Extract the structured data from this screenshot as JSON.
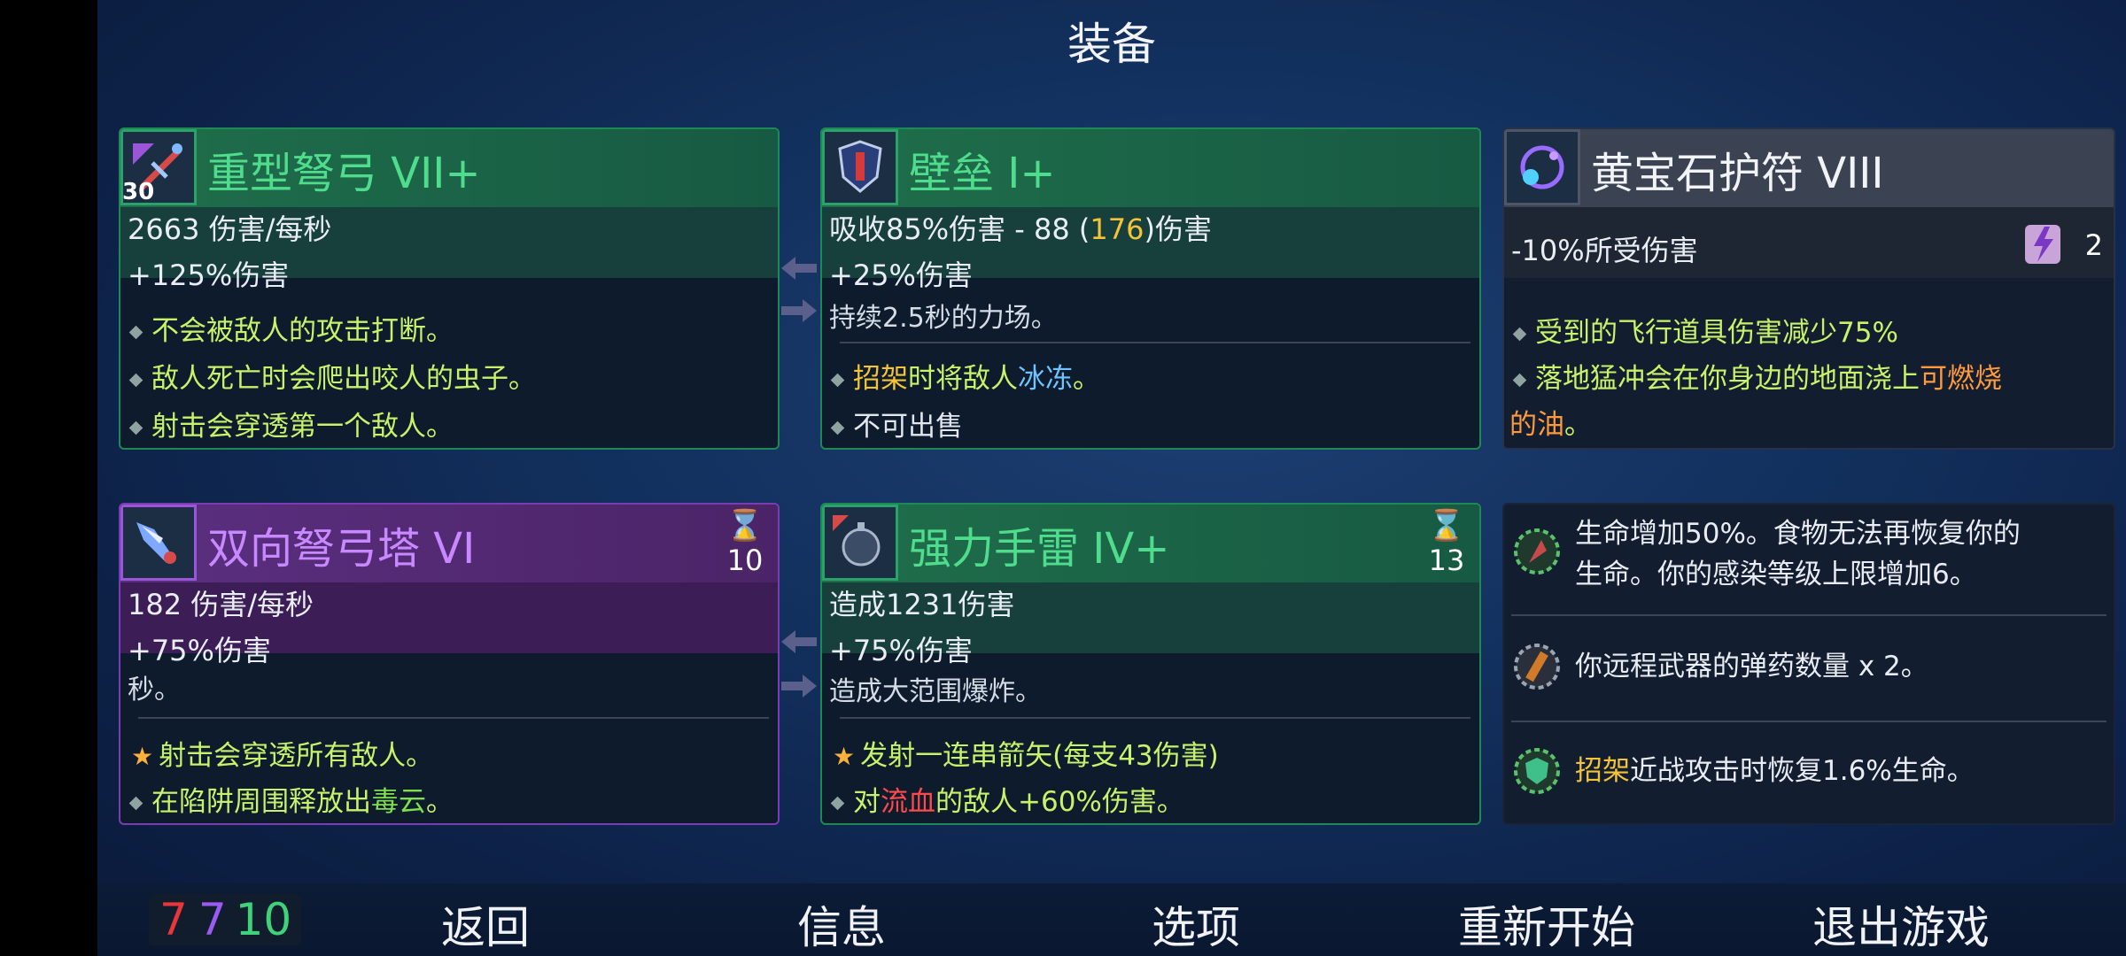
{
  "header": {
    "title": "装备"
  },
  "weapons": [
    {
      "level_badge": "30",
      "name": "重型弩弓 VII+",
      "dps": "2663 伤害/每秒",
      "bonus": "+125%伤害",
      "bullets": [
        "不会被敌人的攻击打断。",
        "敌人死亡时会爬出咬人的虫子。",
        "射击会穿透第一个敌人。"
      ]
    },
    {
      "name": "壁垒 I+",
      "stat_a": "吸收85%伤害 - 88 (",
      "stat_highlight": "176",
      "stat_b": ")伤害",
      "bonus": "+25%伤害",
      "desc": "持续2.5秒的力场。",
      "bullet1_a": "招架",
      "bullet1_b": "时将敌人",
      "bullet1_c": "冰冻",
      "bullet1_d": "。",
      "bullet2": "不可出售"
    },
    {
      "name": "黄宝石护符 VIII",
      "stat": "-10%所受伤害",
      "scroll_count": "2",
      "bullet1": "受到的飞行道具伤害减少75%",
      "bullet2_a": "落地猛冲会在你身边的地面浇上",
      "bullet2_b": "可燃烧",
      "bullet2_c": "的油",
      "bullet2_d": "。"
    },
    {
      "name": "双向弩弓塔 VI",
      "timer": "10",
      "dps": "182 伤害/每秒",
      "bonus": "+75%伤害",
      "desc": "秒。",
      "bullet1": "射击会穿透所有敌人。",
      "bullet2_a": "在陷阱周围释放出",
      "bullet2_b": "毒云",
      "bullet2_c": "。"
    },
    {
      "name": "强力手雷 IV+",
      "timer": "13",
      "dmg": "造成1231伤害",
      "bonus": "+75%伤害",
      "desc": "造成大范围爆炸。",
      "bullet1": "发射一连串箭矢(每支43伤害)",
      "bullet2_a": "对",
      "bullet2_b": "流血",
      "bullet2_c": "的敌人+60%伤害。"
    }
  ],
  "mutations": {
    "m1_line1": "生命增加50%。食物无法再恢复你的",
    "m1_line2": "生命。你的感染等级上限增加6。",
    "m2": "你远程武器的弹药数量 x 2。",
    "m3_a": "招架",
    "m3_b": "近战攻击时恢复1.6%生命。"
  },
  "stats": {
    "brutality": "7",
    "tactics": "7",
    "survival": "10",
    "colors": {
      "brutality": "#e8363a",
      "tactics": "#9a5cf0",
      "survival": "#3fd27a"
    }
  },
  "nav": [
    "返回",
    "信息",
    "选项",
    "重新开始",
    "退出游戏"
  ]
}
